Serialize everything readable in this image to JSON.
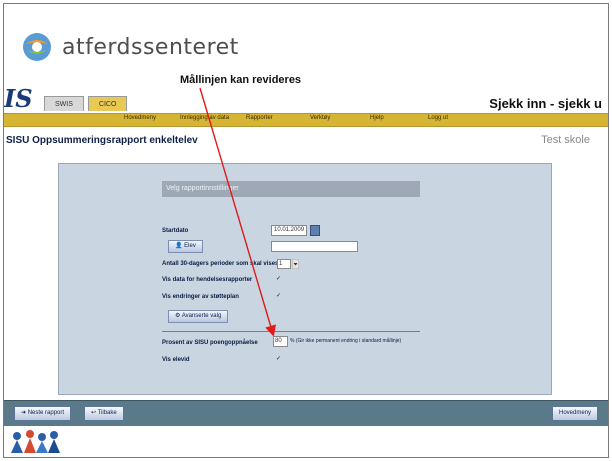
{
  "brand": {
    "name": "atferdssenteret",
    "logo_icon": "atferdssenteret-logo-icon"
  },
  "callout": {
    "text": "Mållinjen kan revideres",
    "arrow_color": "#e11919"
  },
  "app": {
    "logo_text": "IS",
    "tabs": [
      {
        "label": "SWIS"
      },
      {
        "label": "CICO"
      }
    ],
    "motto": "Sjekk inn - sjekk u",
    "menu": [
      {
        "label": "Hovedmeny"
      },
      {
        "label": "Innlegging av data"
      },
      {
        "label": "Rapporter"
      },
      {
        "label": "Verktøy"
      },
      {
        "label": "Hjelp"
      },
      {
        "label": "Logg ut"
      }
    ],
    "page_title": "SISU Oppsummeringsrapport enkeltelev",
    "school": "Test skole"
  },
  "form": {
    "header": "Velg rapportinnstillinger",
    "startdato_label": "Startdato",
    "startdato_value": "10.01.2009",
    "elev_button": "Elev",
    "antall_label": "Antall 30-dagers perioder som skal vises",
    "antall_value": "1",
    "hendelses_label": "Vis data for hendelsesrapporter",
    "endringer_label": "Vis endringer av støtteplan",
    "avanserte_button": "Avanserte valg",
    "prosent_label": "Prosent av SISU poengoppnåelse",
    "prosent_value": "80",
    "prosent_note": "% (Gir ikke permanent endring i standard mållinje)",
    "vis_elevid_label": "Vis elevid",
    "check_mark": "✓"
  },
  "footer": {
    "next_button": "Neste rapport",
    "back_button": "Tilbake",
    "main_button": "Hovedmeny"
  },
  "colors": {
    "menubar": "#d7b534",
    "panel": "#c9d6e2",
    "footer": "#5b7a89",
    "title": "#0e1f4a"
  }
}
